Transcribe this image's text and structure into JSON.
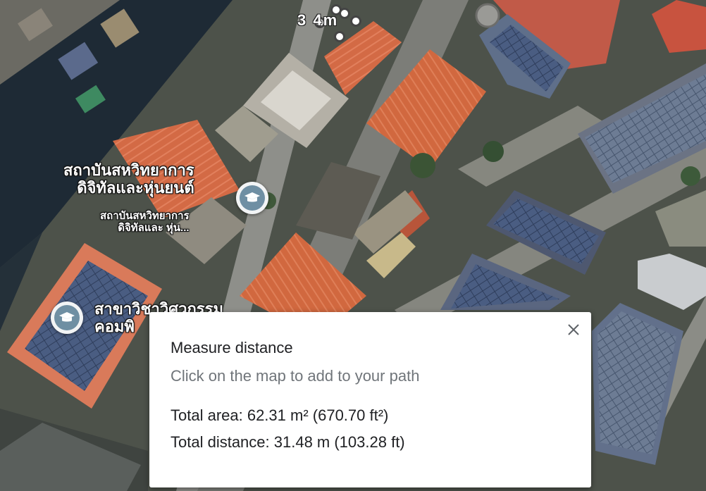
{
  "map": {
    "measure_label": "3  4m",
    "pois": [
      {
        "name_line1": "สถาบันสหวิทยาการ",
        "name_line2": "ดิจิทัลและหุ่นยนต์",
        "sub_line1": "สถาบันสหวิทยาการ",
        "sub_line2": "ดิจิทัลและ หุ่น..."
      },
      {
        "name_line1": "สาขาวิชาวิศวกรรม",
        "name_line2": "คอมพิ"
      }
    ],
    "icons": {
      "poi": "graduation-cap-icon",
      "close": "close-icon"
    }
  },
  "panel": {
    "title": "Measure distance",
    "hint": "Click on the map to add to your path",
    "total_area": "Total area: 62.31 m² (670.70 ft²)",
    "total_distance": "Total distance: 31.48 m (103.28 ft)"
  },
  "colors": {
    "roof_orange": "#d9714e",
    "solar_blue": "#3c4e6e",
    "road": "#8e8f8a",
    "pin": "#6f8fa3"
  }
}
